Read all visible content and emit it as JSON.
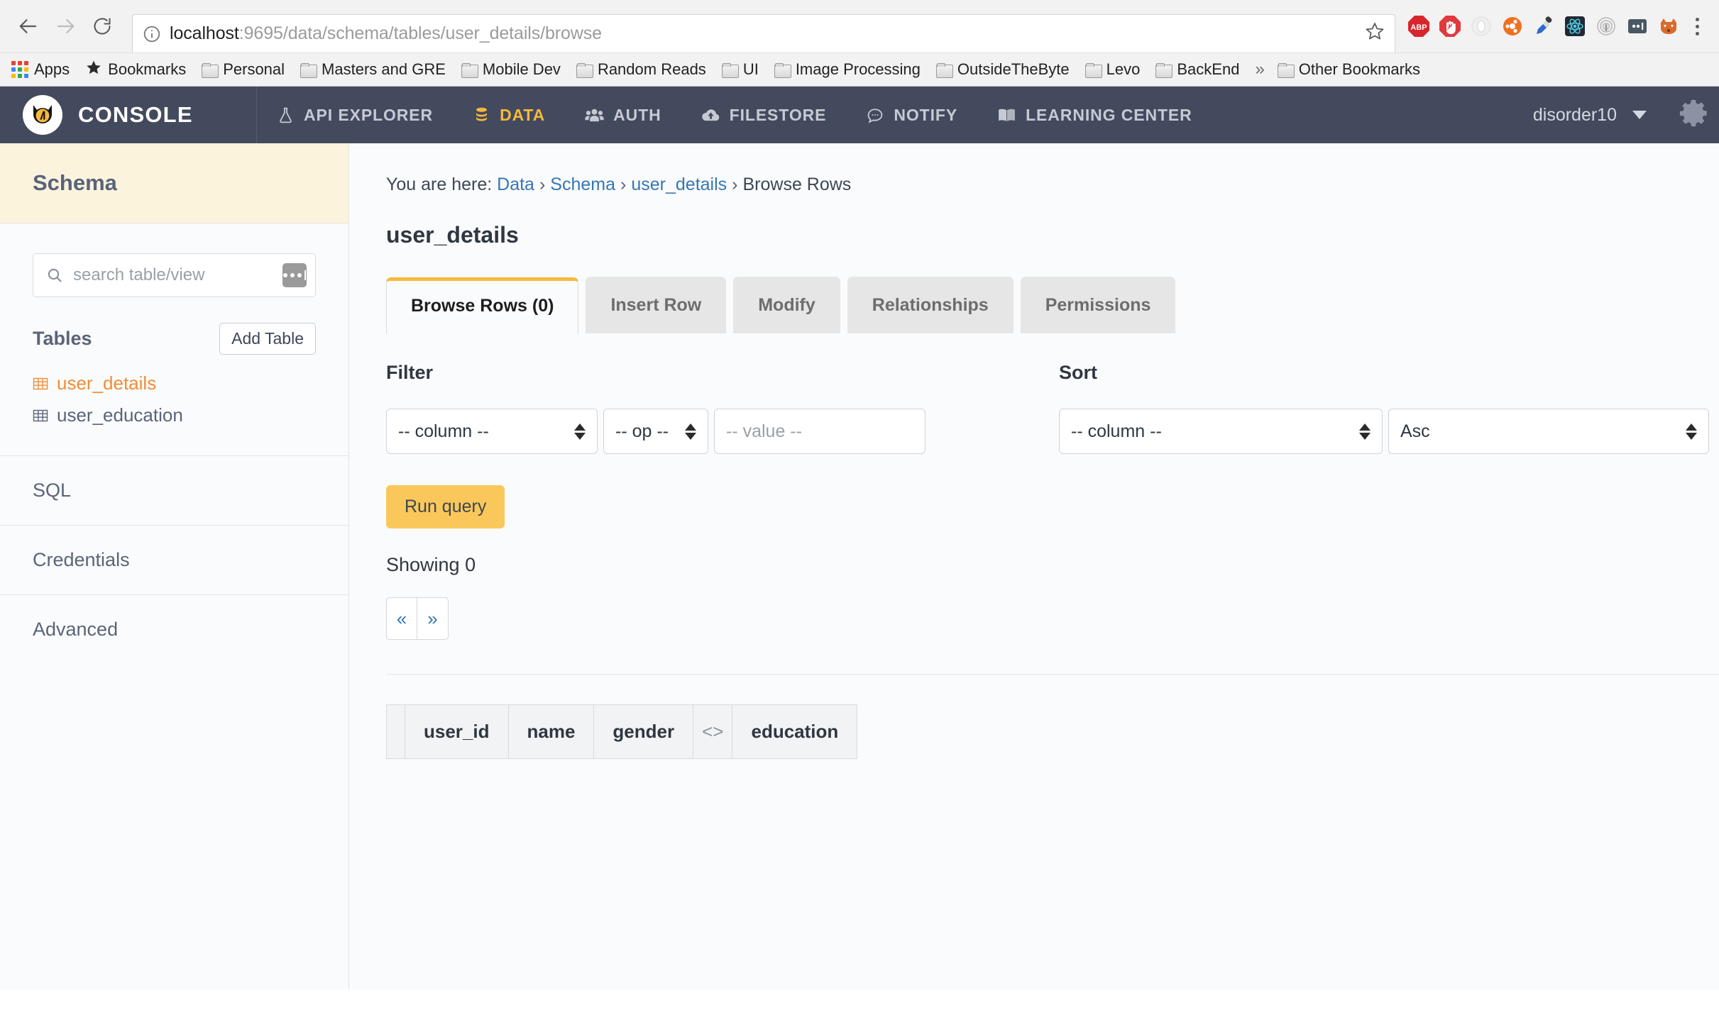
{
  "browser": {
    "back_label": "Back",
    "forward_label": "Forward",
    "reload_label": "Reload",
    "url_host": "localhost",
    "url_path": ":9695/data/schema/tables/user_details/browse",
    "bookmark_star": "☆",
    "extensions": [
      {
        "name": "adblock-plus-icon",
        "label": "ABP"
      },
      {
        "name": "adblock-hand-icon",
        "label": ""
      },
      {
        "name": "ghostery-icon",
        "label": ""
      },
      {
        "name": "ubuntu-icon",
        "label": ""
      },
      {
        "name": "colorzilla-eyedropper-icon",
        "label": ""
      },
      {
        "name": "react-devtools-icon",
        "label": ""
      },
      {
        "name": "wifi-signal-icon",
        "label": ""
      },
      {
        "name": "lastpass-icon",
        "label": ""
      },
      {
        "name": "firefox-fox-icon",
        "label": ""
      }
    ],
    "bookmarks": [
      {
        "label": "Apps",
        "icon": "apps-grid-icon"
      },
      {
        "label": "Bookmarks",
        "icon": "star-icon"
      },
      {
        "label": "Personal",
        "icon": "folder-icon"
      },
      {
        "label": "Masters and GRE",
        "icon": "folder-icon"
      },
      {
        "label": "Mobile Dev",
        "icon": "folder-icon"
      },
      {
        "label": "Random Reads",
        "icon": "folder-icon"
      },
      {
        "label": "UI",
        "icon": "folder-icon"
      },
      {
        "label": "Image Processing",
        "icon": "folder-icon"
      },
      {
        "label": "OutsideTheByte",
        "icon": "folder-icon"
      },
      {
        "label": "Levo",
        "icon": "folder-icon"
      },
      {
        "label": "BackEnd",
        "icon": "folder-icon"
      }
    ],
    "overflow_chevron": "»",
    "other_bookmarks": "Other Bookmarks"
  },
  "navbar": {
    "brand": "CONSOLE",
    "items": [
      {
        "label": "API EXPLORER",
        "icon": "flask-icon",
        "active": false
      },
      {
        "label": "DATA",
        "icon": "database-icon",
        "active": true
      },
      {
        "label": "AUTH",
        "icon": "users-icon",
        "active": false
      },
      {
        "label": "FILESTORE",
        "icon": "cloud-upload-icon",
        "active": false
      },
      {
        "label": "NOTIFY",
        "icon": "chat-bubble-icon",
        "active": false
      },
      {
        "label": "LEARNING CENTER",
        "icon": "book-icon",
        "active": false
      }
    ],
    "user": "disorder10",
    "accent_color": "#f6b93b",
    "bg_color": "#434a5e"
  },
  "sidebar": {
    "header": "Schema",
    "header_bg": "#fcf3dd",
    "search_placeholder": "search table/view",
    "tables_label": "Tables",
    "add_table_label": "Add Table",
    "tables": [
      {
        "name": "user_details",
        "active": true
      },
      {
        "name": "user_education",
        "active": false
      }
    ],
    "sections": [
      {
        "label": "SQL"
      },
      {
        "label": "Credentials"
      },
      {
        "label": "Advanced"
      }
    ],
    "active_color": "#f08d37"
  },
  "main": {
    "breadcrumb_prefix": "You are here:",
    "breadcrumb": [
      {
        "label": "Data",
        "link": true
      },
      {
        "label": "Schema",
        "link": true
      },
      {
        "label": "user_details",
        "link": true
      },
      {
        "label": "Browse Rows",
        "link": false
      }
    ],
    "title": "user_details",
    "tabs": [
      {
        "label": "Browse Rows (0)",
        "active": true
      },
      {
        "label": "Insert Row",
        "active": false
      },
      {
        "label": "Modify",
        "active": false
      },
      {
        "label": "Relationships",
        "active": false
      },
      {
        "label": "Permissions",
        "active": false
      }
    ],
    "filter": {
      "label": "Filter",
      "column_value": "-- column --",
      "op_value": "-- op --",
      "value_placeholder": "-- value --"
    },
    "sort": {
      "label": "Sort",
      "column_value": "-- column --",
      "direction_value": "Asc"
    },
    "run_query_label": "Run query",
    "showing_label": "Showing 0",
    "pager": {
      "prev": "«",
      "next": "»"
    },
    "table_headers": [
      "",
      "user_id",
      "name",
      "gender",
      "<>",
      "education"
    ],
    "run_button_color": "#fac85a"
  }
}
